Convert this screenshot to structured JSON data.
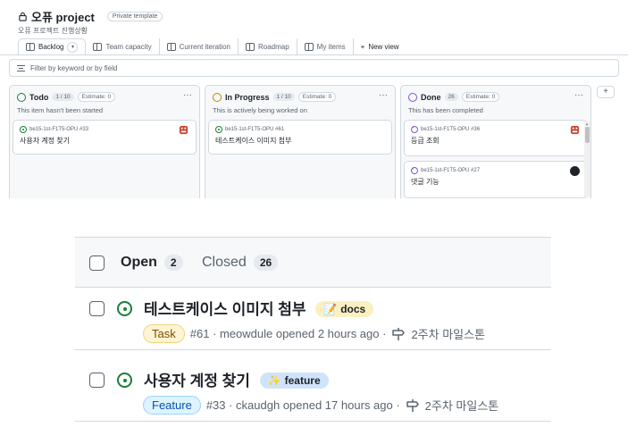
{
  "project": {
    "title": "오퓨 project",
    "visibility_badge": "Private template",
    "subtitle": "오퓨 프로젝트 진행상황"
  },
  "views": {
    "tabs": [
      {
        "label": "Backlog",
        "icon": "table-icon"
      },
      {
        "label": "Team capacity",
        "icon": "table-icon"
      },
      {
        "label": "Current iteration",
        "icon": "board-icon"
      },
      {
        "label": "Roadmap",
        "icon": "roadmap-icon"
      },
      {
        "label": "My items",
        "icon": "table-icon"
      }
    ],
    "new_view": "New view"
  },
  "filter": {
    "placeholder": "Filter by keyword or by field"
  },
  "columns": [
    {
      "name": "Todo",
      "count": "1 / 10",
      "estimate": "Estimate: 0",
      "description": "This item hasn't been started",
      "color": "#1a7f37",
      "cards": [
        {
          "ref": "be15-1st-F1T5-OPU #33",
          "title": "사용자 계정 찾기"
        }
      ]
    },
    {
      "name": "In Progress",
      "count": "1 / 10",
      "estimate": "Estimate: 0",
      "description": "This is actively being worked on",
      "color": "#bf8700",
      "cards": [
        {
          "ref": "be15-1st-F1T5-OPU #61",
          "title": "테스트케이스 이미지 첨부"
        }
      ]
    },
    {
      "name": "Done",
      "count": "26",
      "estimate": "Estimate: 0",
      "description": "This has been completed",
      "color": "#8250df",
      "cards": [
        {
          "ref": "be15-1st-F1T5-OPU #36",
          "title": "등급 조회"
        },
        {
          "ref": "be15-1st-F1T5-OPU #27",
          "title": "댓글 기능"
        }
      ]
    }
  ],
  "issue_list": {
    "open_label": "Open",
    "open_count": "2",
    "closed_label": "Closed",
    "closed_count": "26",
    "issues": [
      {
        "title": "테스트케이스 이미지 첨부",
        "label": "docs",
        "label_emoji": "📝",
        "label_color": "#fbf0c2",
        "type": "Task",
        "meta": "#61 · meowdule opened 2 hours ago ·",
        "milestone": "2주차 마일스톤"
      },
      {
        "title": "사용자 계정 찾기",
        "label": "feature",
        "label_emoji": "✨",
        "label_color": "#cfe3fb",
        "type": "Feature",
        "meta": "#33 · ckaudgh opened 17 hours ago ·",
        "milestone": "2주차 마일스톤"
      }
    ]
  }
}
